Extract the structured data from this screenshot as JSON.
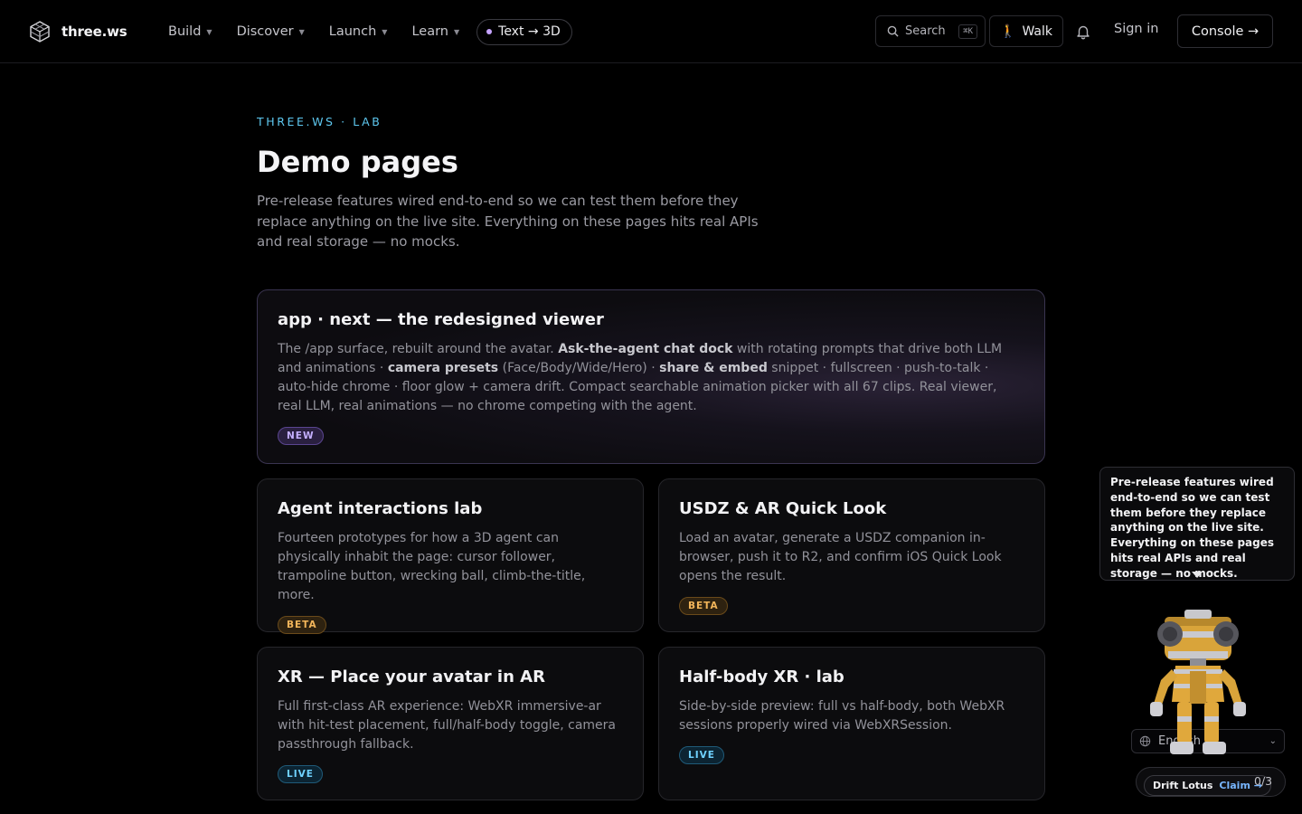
{
  "brand": {
    "name": "three.ws"
  },
  "nav": {
    "items": [
      {
        "label": "Build"
      },
      {
        "label": "Discover"
      },
      {
        "label": "Launch"
      },
      {
        "label": "Learn"
      }
    ],
    "pill_label": "Text → 3D"
  },
  "toolbar": {
    "search_label": "Search",
    "search_shortcut": "⌘K",
    "walk_label": "Walk",
    "signin_label": "Sign in",
    "console_label": "Console →"
  },
  "intro": {
    "eyebrow": "THREE.WS · LAB",
    "title": "Demo pages",
    "lede": "Pre-release features wired end-to-end so we can test them before they replace anything on the live site. Everything on these pages hits real APIs and real storage — no mocks."
  },
  "featured": {
    "title": "app · next — the redesigned viewer",
    "desc_1": "The /app surface, rebuilt around the avatar. ",
    "desc_b1": "Ask-the-agent chat dock",
    "desc_2": " with rotating prompts that drive both LLM and animations · ",
    "desc_b2": "camera presets",
    "desc_3": " (Face/Body/Wide/Hero) · ",
    "desc_b3": "share & embed",
    "desc_4": " snippet · fullscreen · push-to-talk · auto-hide chrome · floor glow + camera drift. Compact searchable animation picker with all 67 clips. Real viewer, real LLM, real animations — no chrome competing with the agent.",
    "badge": "NEW"
  },
  "cards": [
    {
      "title": "Agent interactions lab",
      "desc": "Fourteen prototypes for how a 3D agent can physically inhabit the page: cursor follower, trampoline button, wrecking ball, climb-the-title, more.",
      "badge": "BETA"
    },
    {
      "title": "USDZ & AR Quick Look",
      "desc": "Load an avatar, generate a USDZ companion in-browser, push it to R2, and confirm iOS Quick Look opens the result.",
      "badge": "BETA"
    },
    {
      "title": "XR — Place your avatar in AR",
      "desc": "Full first-class AR experience: WebXR immersive-ar with hit-test placement, full/half-body toggle, camera passthrough fallback.",
      "badge": "LIVE"
    },
    {
      "title": "Half-body XR · lab",
      "desc": "Side-by-side preview: full vs half-body, both WebXR sessions properly wired via WebXRSession.",
      "badge": "LIVE"
    }
  ],
  "widget": {
    "tooltip": "Pre-release features wired end-to-end so we can test them before they replace anything on the live site. Everything on these pages hits real APIs and real storage — no mocks.",
    "language": "English",
    "quest_name": "Drift Lotus",
    "quest_claim": "Claim →",
    "quest_count": "0/3"
  },
  "colors": {
    "accent_cyan": "#5ec8f0",
    "badge_new": "#c5b0ff",
    "badge_beta": "#f2b55a",
    "badge_live": "#6fd2ff",
    "background": "#000000"
  }
}
